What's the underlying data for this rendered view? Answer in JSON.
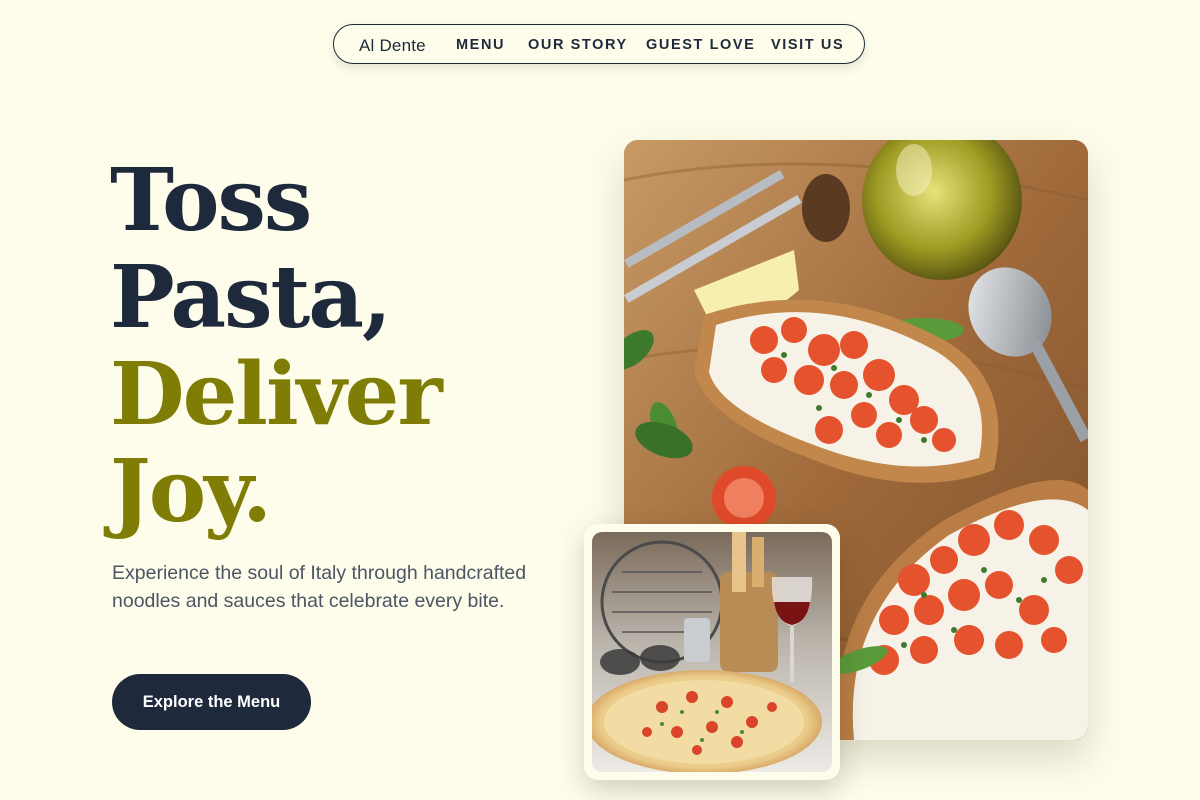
{
  "nav": {
    "brand": "Al Dente",
    "links": [
      "MENU",
      "OUR STORY",
      "GUEST LOVE",
      "VISIT US"
    ]
  },
  "hero": {
    "headline_lines": [
      "Toss",
      "Pasta,",
      "Deliver",
      "Joy."
    ],
    "subtitle": "Experience the soul of Italy through handcrafted noodles and sauces that celebrate every bite.",
    "cta_label": "Explore the Menu"
  },
  "images": {
    "main_photo": "bruschetta-photo",
    "secondary_photo": "pizza-photo"
  },
  "colors": {
    "background": "#FEFDEB",
    "navy": "#1E293B",
    "olive": "#7F7D05",
    "body_text": "#4B5563"
  }
}
